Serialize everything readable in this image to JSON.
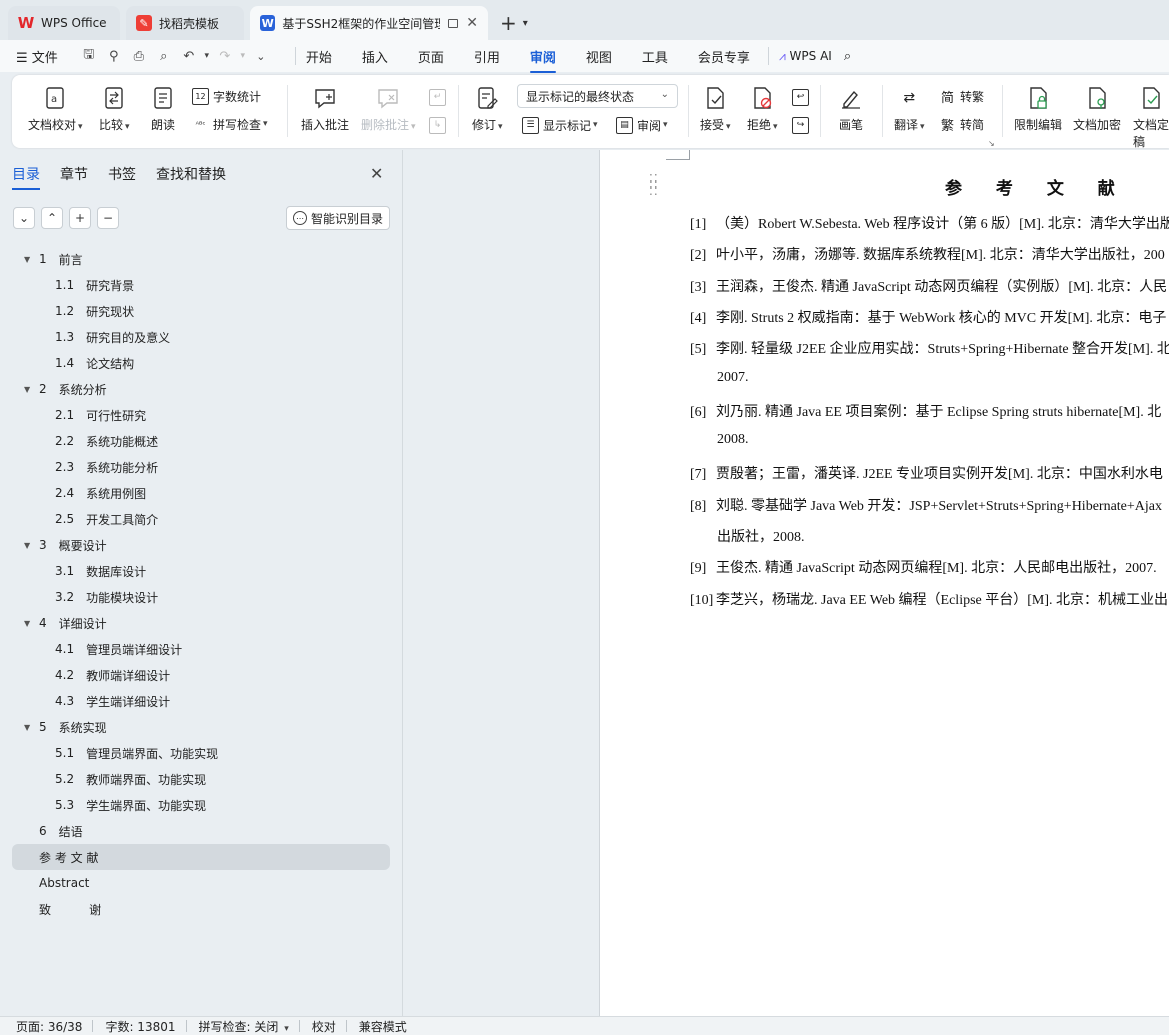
{
  "tabs": [
    {
      "label": "WPS Office",
      "icon": "wps-logo-icon"
    },
    {
      "label": "找稻壳模板",
      "icon": "daoke-icon"
    },
    {
      "label": "基于SSH2框架的作业空间管理",
      "icon": "word-doc-icon"
    }
  ],
  "menu": {
    "file": "文件",
    "items": [
      "开始",
      "插入",
      "页面",
      "引用",
      "审阅",
      "视图",
      "工具",
      "会员专享"
    ],
    "active": "审阅",
    "wps_ai": "WPS AI"
  },
  "ribbon": {
    "doc_proof": "文档校对",
    "compare": "比较",
    "read_aloud": "朗读",
    "word_count": "字数统计",
    "spell_check": "拼写检查",
    "insert_comment": "插入批注",
    "delete_comment": "删除批注",
    "track_changes": "修订",
    "markup_state": "显示标记的最终状态",
    "show_markup": "显示标记",
    "review": "审阅",
    "accept": "接受",
    "reject": "拒绝",
    "pen": "画笔",
    "translate": "翻译",
    "to_traditional": "转繁",
    "to_simplified": "转简",
    "restrict_edit": "限制编辑",
    "encrypt": "文档加密",
    "finalize": "文档定稿"
  },
  "sidebar": {
    "tabs": [
      "目录",
      "章节",
      "书签",
      "查找和替换"
    ],
    "active_tab": "目录",
    "smart_toc": "智能识别目录",
    "toc": [
      {
        "level": 1,
        "num": "1",
        "title": "前言",
        "expanded": true
      },
      {
        "level": 2,
        "num": "1.1",
        "title": "研究背景"
      },
      {
        "level": 2,
        "num": "1.2",
        "title": "研究现状"
      },
      {
        "level": 2,
        "num": "1.3",
        "title": "研究目的及意义"
      },
      {
        "level": 2,
        "num": "1.4",
        "title": "论文结构"
      },
      {
        "level": 1,
        "num": "2",
        "title": "系统分析",
        "expanded": true
      },
      {
        "level": 2,
        "num": "2.1",
        "title": "可行性研究"
      },
      {
        "level": 2,
        "num": "2.2",
        "title": "系统功能概述"
      },
      {
        "level": 2,
        "num": "2.3",
        "title": "系统功能分析"
      },
      {
        "level": 2,
        "num": "2.4",
        "title": "系统用例图"
      },
      {
        "level": 2,
        "num": "2.5",
        "title": "开发工具简介"
      },
      {
        "level": 1,
        "num": "3",
        "title": "概要设计",
        "expanded": true
      },
      {
        "level": 2,
        "num": "3.1",
        "title": "数据库设计"
      },
      {
        "level": 2,
        "num": "3.2",
        "title": "功能模块设计"
      },
      {
        "level": 1,
        "num": "4",
        "title": "详细设计",
        "expanded": true
      },
      {
        "level": 2,
        "num": "4.1",
        "title": "管理员端详细设计"
      },
      {
        "level": 2,
        "num": "4.2",
        "title": "教师端详细设计"
      },
      {
        "level": 2,
        "num": "4.3",
        "title": "学生端详细设计"
      },
      {
        "level": 1,
        "num": "5",
        "title": "系统实现",
        "expanded": true
      },
      {
        "level": 2,
        "num": "5.1",
        "title": "管理员端界面、功能实现"
      },
      {
        "level": 2,
        "num": "5.2",
        "title": "教师端界面、功能实现"
      },
      {
        "level": 2,
        "num": "5.3",
        "title": "学生端界面、功能实现"
      },
      {
        "level": 0,
        "num": "6",
        "title": "结语"
      },
      {
        "level": 0,
        "num": "",
        "title": "参 考 文 献",
        "selected": true
      },
      {
        "level": 0,
        "num": "",
        "title": "Abstract"
      },
      {
        "level": 0,
        "num": "",
        "title": "致          谢"
      }
    ]
  },
  "document": {
    "title": "参 考 文 献",
    "refs": [
      {
        "n": "[1]",
        "text": "（美）Robert W.Sebesta. Web 程序设计（第 6 版）[M]. 北京：清华大学出版"
      },
      {
        "n": "[2]",
        "text": "叶小平，汤庸，汤娜等. 数据库系统教程[M]. 北京：清华大学出版社，200"
      },
      {
        "n": "[3]",
        "text": "王润森，王俊杰. 精通 JavaScript 动态网页编程（实例版）[M]. 北京：人民"
      },
      {
        "n": "[4]",
        "text": "李刚. Struts 2 权威指南：基于 WebWork 核心的 MVC 开发[M]. 北京：电子"
      },
      {
        "n": "[5]",
        "text": "李刚. 轻量级 J2EE 企业应用实战：Struts+Spring+Hibernate 整合开发[M]. 北",
        "cont": "2007."
      },
      {
        "n": "[6]",
        "text": "刘乃丽. 精通 Java EE 项目案例：基于 Eclipse Spring struts hibernate[M]. 北",
        "cont": "2008."
      },
      {
        "n": "[7]",
        "text": "贾殷著；王雷，潘英译. J2EE 专业项目实例开发[M]. 北京：中国水利水电"
      },
      {
        "n": "[8]",
        "text": "刘聪. 零基础学 Java Web 开发：JSP+Servlet+Struts+Spring+Hibernate+Ajax",
        "cont": "出版社，2008."
      },
      {
        "n": "[9]",
        "text": "王俊杰. 精通 JavaScript 动态网页编程[M]. 北京：人民邮电出版社，2007."
      },
      {
        "n": "[10]",
        "text": "李芝兴，杨瑞龙. Java EE Web 编程（Eclipse 平台）[M]. 北京：机械工业出"
      }
    ]
  },
  "status": {
    "page": "页面: 36/38",
    "words": "字数: 13801",
    "spell": "拼写检查: 关闭",
    "proof": "校对",
    "compat": "兼容模式"
  },
  "colors": {
    "accent": "#1b5fd6"
  }
}
